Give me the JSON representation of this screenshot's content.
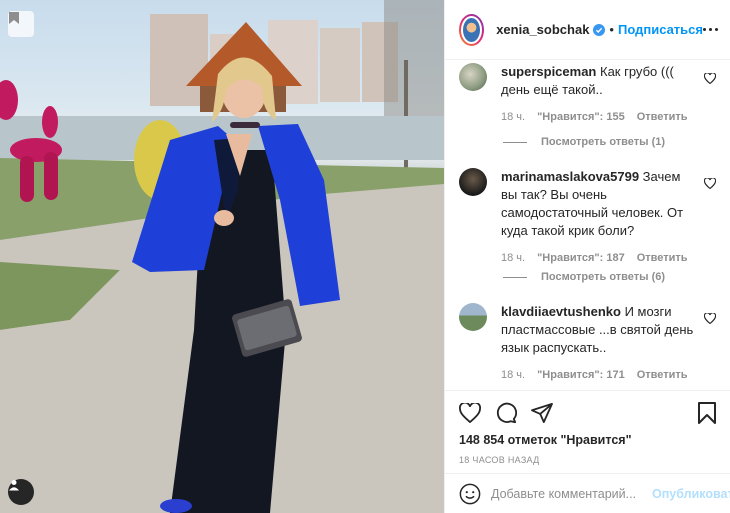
{
  "post": {
    "photo_alt": ""
  },
  "header": {
    "username": "xenia_sobchak",
    "dot": "•",
    "follow_label": "Подписаться"
  },
  "comments": [
    {
      "username": "superspiceman",
      "text": "Как грубо ((( день ещё такой..",
      "time": "18 ч.",
      "likes": "\"Нравится\": 155",
      "reply_label": "Ответить",
      "view_replies": "Посмотреть ответы (1)"
    },
    {
      "username": "marinamaslakova5799",
      "text": "Зачем вы так? Вы очень самодостаточный человек. От куда такой крик боли?",
      "time": "18 ч.",
      "likes": "\"Нравится\": 187",
      "reply_label": "Ответить",
      "view_replies": "Посмотреть ответы (6)"
    },
    {
      "username": "klavdiiaevtushenko",
      "text": "И мозги пластмассовые ...в святой день язык распускать..",
      "time": "18 ч.",
      "likes": "\"Нравится\": 171",
      "reply_label": "Ответить"
    }
  ],
  "summary": {
    "likes_text": "148 854 отметок \"Нравится\"",
    "time_ago": "18 ЧАСОВ НАЗАД"
  },
  "add_comment": {
    "placeholder": "Добавьте комментарий...",
    "publish_label": "Опубликовать"
  },
  "colors": {
    "accent": "#0095f6",
    "publish_disabled": "#b2dffc",
    "muted": "#8e8e8e",
    "text": "#262626",
    "jacket_blue": "#1e3fd8"
  },
  "icons": {
    "header": [
      "verified-badge-icon",
      "more-options-icon"
    ],
    "comment": "heart-outline-icon",
    "actions": [
      "heart-outline-icon",
      "comment-icon",
      "share-icon",
      "bookmark-icon"
    ],
    "composer": "emoji-icon",
    "photo": [
      "save-image-icon",
      "user-tag-icon"
    ]
  }
}
